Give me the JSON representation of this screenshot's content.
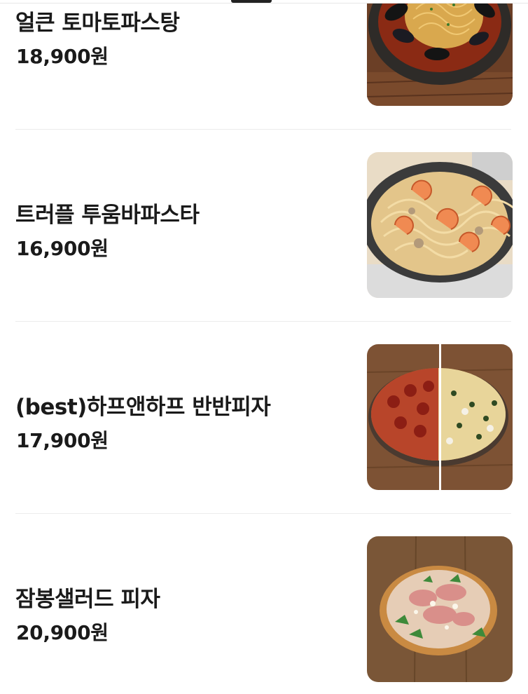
{
  "menu": {
    "items": [
      {
        "name": "얼큰 토마토파스탕",
        "price": "18,900원",
        "image": "spicy-tomato-mussel-pasta-photo"
      },
      {
        "name": "트러플 투움바파스타",
        "price": "16,900원",
        "image": "truffle-toowoomba-shrimp-pasta-photo"
      },
      {
        "name": "(best)하프앤하프 반반피자",
        "price": "17,900원",
        "image": "half-and-half-pizza-photo"
      },
      {
        "name": "잠봉샐러드 피자",
        "price": "20,900원",
        "image": "jambon-salad-pizza-photo"
      }
    ]
  }
}
